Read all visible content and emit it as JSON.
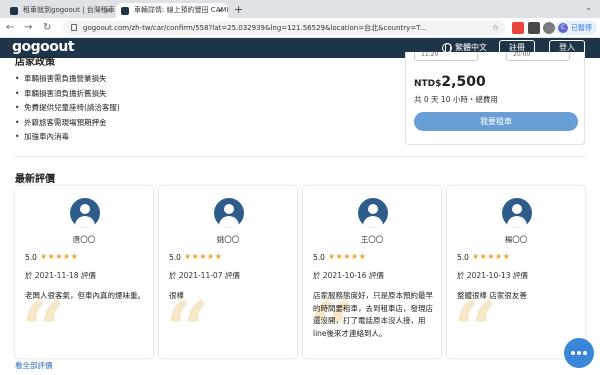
{
  "browser": {
    "tabs": [
      {
        "title": "租車就到gogoout | 台灣租車_比",
        "active": false
      },
      {
        "title": "車輛詳情: 線上預約豐田 CAMR",
        "active": true
      }
    ],
    "url": "gogoout.com/zh-tw/car/confirm/558?lat=25.032939&lng=121.56529&location=台北&country=T...",
    "profile_label": "已暫停",
    "profile_initial": "C"
  },
  "header": {
    "logo": "gogoout",
    "language": "繁體中文",
    "register_label": "註冊",
    "login_label": "登入"
  },
  "policy": {
    "title": "店家政策",
    "items": [
      "車輛損害需負擔營業損失",
      "車輛損害須負擔折舊損失",
      "免費提供兒童座椅(請洽客服)",
      "外籍旅客需現場預期押金",
      "加強車內消毒"
    ]
  },
  "booking": {
    "pickup_time": "11:20",
    "return_time": "20:00",
    "currency": "NTD$",
    "price": "2,500",
    "duration": "共 0 天 10 小時・總費用",
    "rent_button": "我要租車"
  },
  "reviews": {
    "title": "最新評價",
    "see_all": "看全部評價",
    "items": [
      {
        "name": "唐〇〇",
        "score": "5.0",
        "stars": "★★★★★",
        "date": "於 2021-11-18 評價",
        "text": "老闆人很客氣，但車內真的煙味重。"
      },
      {
        "name": "姚〇〇",
        "score": "5.0",
        "stars": "★★★★★",
        "date": "於 2021-11-07 評價",
        "text": "很棒"
      },
      {
        "name": "王〇〇",
        "score": "5.0",
        "stars": "★★★★★",
        "date": "於 2021-10-16 評價",
        "text": "店家服務態度好，只是原本預約最早的時間要租車，去到租車店，發現店還沒開，打了電話原本沒人接，用line後來才連絡到人。"
      },
      {
        "name": "楊〇〇",
        "score": "5.0",
        "stars": "★★★★★",
        "date": "於 2021-10-13 評價",
        "text": "整體很棒 店家很友善"
      }
    ]
  },
  "colors": {
    "header_bg": "#1e3448",
    "rent_button": "#6a9ed6",
    "star": "#f5a623",
    "link": "#2a6ebb",
    "chat": "#3a86d8"
  }
}
